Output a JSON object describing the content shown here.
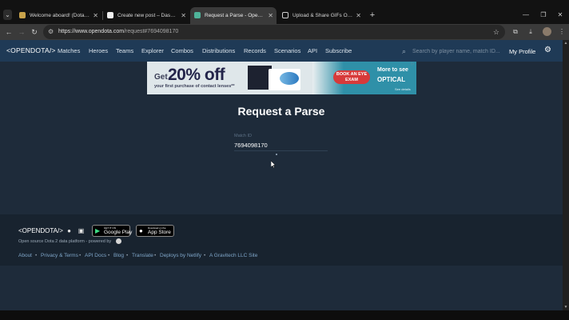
{
  "browser": {
    "tabs": [
      {
        "title": "Welcome aboard! (Dotabuff)",
        "active": false
      },
      {
        "title": "Create new post – Dashboard",
        "active": false
      },
      {
        "title": "Request a Parse - OpenDota -",
        "active": true
      },
      {
        "title": "Upload & Share GIFs Online | G",
        "active": false
      }
    ],
    "url_host": "https://www.opendota.com",
    "url_path": "/request#7694098170",
    "colors": {
      "tabstrip": "#121212",
      "active_tab": "#3a3a3a"
    }
  },
  "header": {
    "logo": "<OPENDOTA/>",
    "nav": [
      "Matches",
      "Heroes",
      "Teams",
      "Explorer",
      "Combos",
      "Distributions",
      "Records",
      "Scenarios",
      "API",
      "Subscribe"
    ],
    "search_placeholder": "Search by player name, match ID...",
    "my_profile": "My Profile",
    "colors": {
      "header_bg": "#1f3a56",
      "page_bg": "#1e2b3a"
    }
  },
  "ad": {
    "get": "Get",
    "discount": "20% off",
    "fine_print": "your first purchase of contact lenses**",
    "book_button": "BOOK AN EYE EXAM",
    "more": "More to see",
    "optical": "OPTICAL",
    "see_more": "See details"
  },
  "main": {
    "title": "Request a Parse",
    "field_label": "Match ID",
    "match_id": "7694098170"
  },
  "footer": {
    "logo": "<OPENDOTA/>",
    "badge_google_small": "GET IT ON",
    "badge_google_big": "Google Play",
    "badge_apple_small": "Download on the",
    "badge_apple_big": "App Store",
    "tagline": "Open source Dota 2 data platform - powered by",
    "links": [
      "About",
      "Privacy & Terms",
      "API Docs",
      "Blog",
      "Translate",
      "Deploys by Netlify",
      "A Gravitech LLC Site"
    ],
    "colors": {
      "footer_bg": "#18232f",
      "link": "#7fa6c9"
    }
  }
}
